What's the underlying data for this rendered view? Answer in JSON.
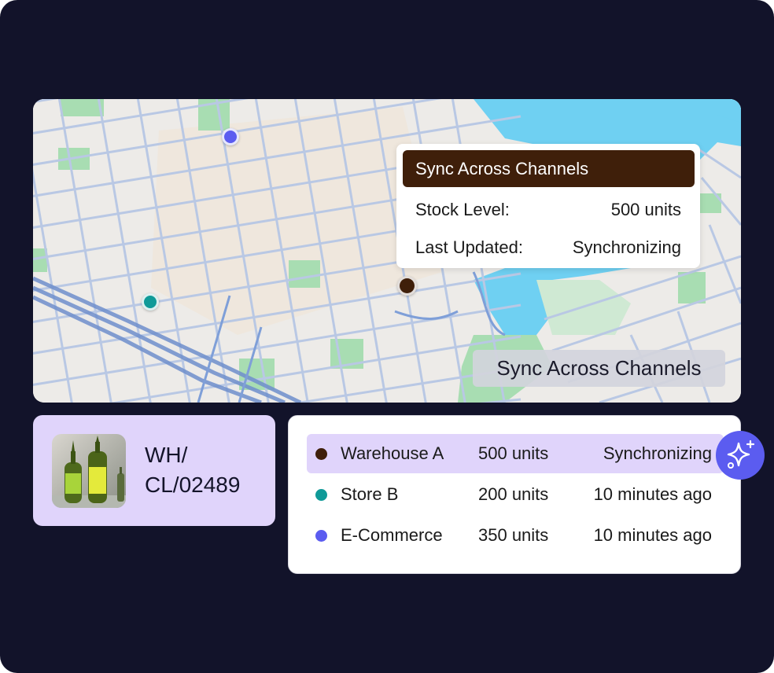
{
  "colors": {
    "background": "#12132a",
    "warehouse": "#3f1f0a",
    "store": "#0f9a98",
    "ecommerce": "#5b5cf0",
    "highlight": "#e0d4fb",
    "water": "#6fd0f2",
    "park": "#a8ddb2"
  },
  "map": {
    "tooltip": {
      "title": "Sync Across Channels",
      "rows": [
        {
          "label": "Stock Level:",
          "value": "500 units"
        },
        {
          "label": "Last Updated:",
          "value": "Synchronizing"
        }
      ]
    },
    "chip_label": "Sync Across Channels"
  },
  "product": {
    "sku_line1": "WH/",
    "sku_line2": "CL/02489"
  },
  "channels": [
    {
      "name": "Warehouse A",
      "units": "500 units",
      "status": "Synchronizing",
      "active": true
    },
    {
      "name": "Store B",
      "units": "200 units",
      "status": "10 minutes ago",
      "active": false
    },
    {
      "name": "E-Commerce",
      "units": "350 units",
      "status": "10 minutes ago",
      "active": false
    }
  ],
  "icons": {
    "ai_button": "sparkle-icon"
  }
}
